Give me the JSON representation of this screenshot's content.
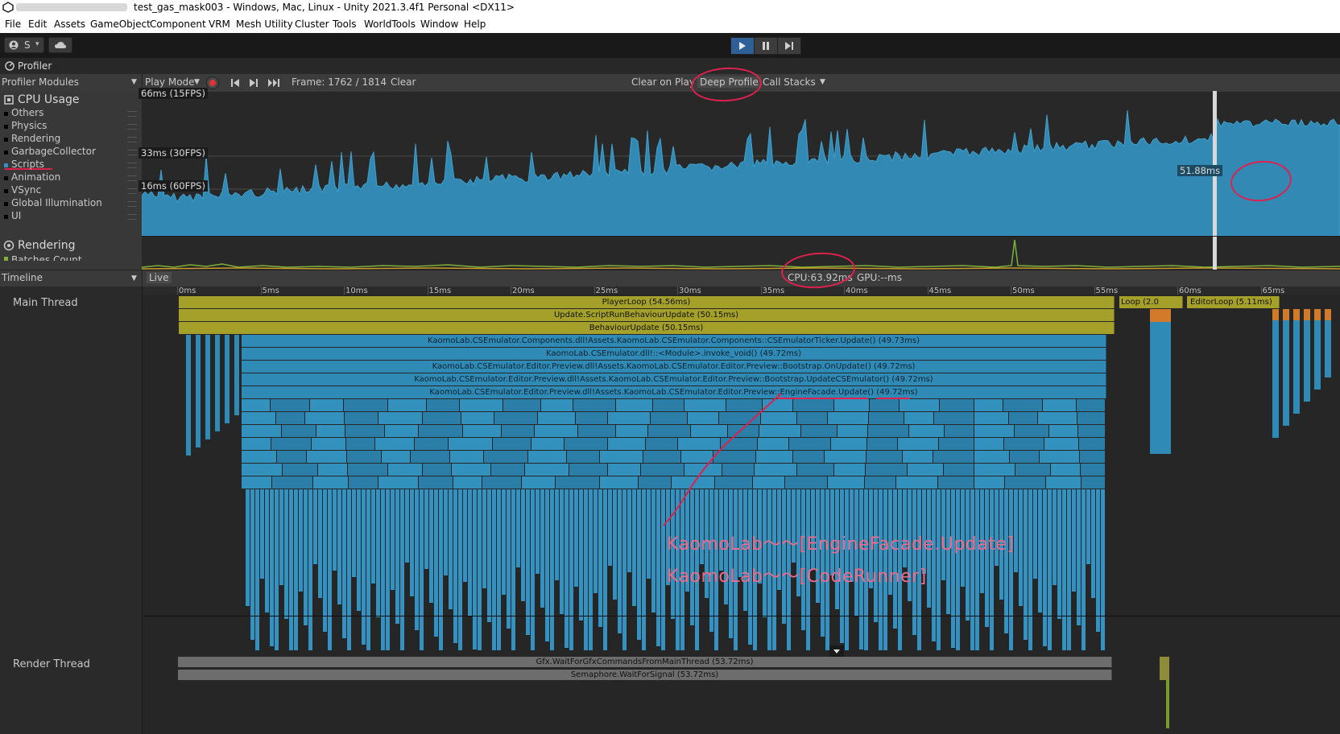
{
  "window": {
    "title": "test_gas_mask003 - Windows, Mac, Linux - Unity 2021.3.4f1 Personal <DX11>"
  },
  "menu": [
    "File",
    "Edit",
    "Assets",
    "GameObject",
    "Component",
    "VRM",
    "Mesh Utility",
    "Cluster",
    "Tools",
    "WorldTools",
    "Window",
    "Help"
  ],
  "toolbar": {
    "account_label": "S"
  },
  "profiler": {
    "tab_label": "Profiler",
    "modules_label": "Profiler Modules",
    "play_mode_label": "Play Mode",
    "frame_label": "Frame: 1762 / 1814",
    "clear_label": "Clear",
    "clear_on_play_label": "Clear on Play",
    "deep_profile_label": "Deep Profile",
    "call_stacks_label": "Call Stacks"
  },
  "cpu_module": {
    "title": "CPU Usage",
    "categories": [
      {
        "label": "Others",
        "color": "#000000"
      },
      {
        "label": "Physics",
        "color": "#000000"
      },
      {
        "label": "Rendering",
        "color": "#000000"
      },
      {
        "label": "GarbageCollector",
        "color": "#000000"
      },
      {
        "label": "Scripts",
        "color": "#3a8ec0"
      },
      {
        "label": "Animation",
        "color": "#000000"
      },
      {
        "label": "VSync",
        "color": "#000000"
      },
      {
        "label": "Global Illumination",
        "color": "#000000"
      },
      {
        "label": "UI",
        "color": "#000000"
      }
    ],
    "grid_labels": [
      "66ms (15FPS)",
      "33ms (30FPS)",
      "16ms (60FPS)"
    ],
    "selected_value": "51.88ms"
  },
  "rendering_module": {
    "title": "Rendering",
    "first_item": "Batches Count"
  },
  "timeline": {
    "view_label": "Timeline",
    "live_label": "Live",
    "cpu_label": "CPU:63.92ms",
    "gpu_label": "GPU:--ms",
    "ticks": [
      "0ms",
      "5ms",
      "10ms",
      "15ms",
      "20ms",
      "25ms",
      "30ms",
      "35ms",
      "40ms",
      "45ms",
      "50ms",
      "55ms",
      "60ms",
      "65ms"
    ],
    "main_thread_label": "Main Thread",
    "render_thread_label": "Render Thread",
    "main_bars": [
      "PlayerLoop (54.56ms)",
      "Update.ScriptRunBehaviourUpdate (50.15ms)",
      "BehaviourUpdate (50.15ms)",
      "KaomoLab.CSEmulator.Components.dll!Assets.KaomoLab.CSEmulator.Components::CSEmulatorTicker.Update() (49.73ms)",
      "KaomoLab.CSEmulator.dll!::<Module>.invoke_void() (49.72ms)",
      "KaomoLab.CSEmulator.Editor.Preview.dll!Assets.KaomoLab.CSEmulator.Editor.Preview::Bootstrap.OnUpdate() (49.72ms)",
      "KaomoLab.CSEmulator.Editor.Preview.dll!Assets.KaomoLab.CSEmulator.Editor.Preview::Bootstrap.UpdateCSEmulator() (49.72ms)",
      "KaomoLab.CSEmulator.Editor.Preview.dll!Assets.KaomoLab.CSEmulator.Editor.Preview::EngineFacade.Update() (49.72ms)"
    ],
    "loop_label": "Loop (2.0",
    "editor_loop_label": "EditorLoop (5.11ms)",
    "render_bars": [
      "Gfx.WaitForGfxCommandsFromMainThread (53.72ms)",
      "Semaphore.WaitForSignal (53.72ms)"
    ]
  },
  "annotations": [
    "KaomoLab～～[EngineFacade.Update]",
    "KaomoLab～～[CodeRunner]"
  ]
}
